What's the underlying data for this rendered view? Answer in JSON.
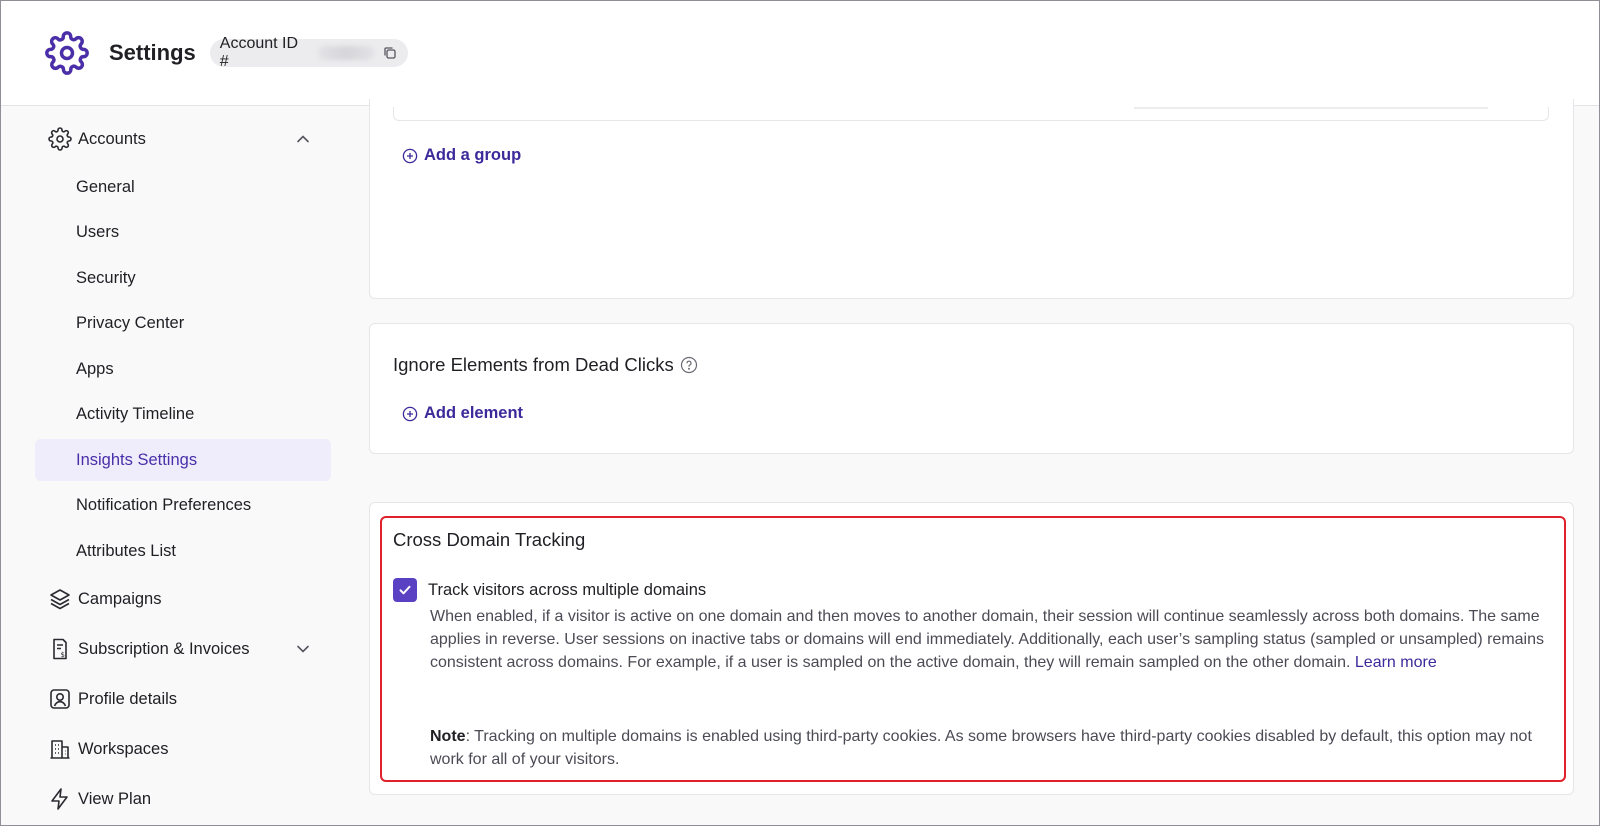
{
  "header": {
    "title": "Settings",
    "account_label": "Account ID #",
    "icons": {
      "logo": "gear-icon",
      "copy": "copy-icon"
    },
    "accent": "#4a2fa8"
  },
  "sidebar": {
    "accounts": {
      "label": "Accounts",
      "icon": "gear-icon",
      "expanded": true
    },
    "children": [
      {
        "label": "General"
      },
      {
        "label": "Users"
      },
      {
        "label": "Security"
      },
      {
        "label": "Privacy Center"
      },
      {
        "label": "Apps"
      },
      {
        "label": "Activity Timeline"
      },
      {
        "label": "Insights Settings",
        "active": true
      },
      {
        "label": "Notification Preferences"
      },
      {
        "label": "Attributes List"
      }
    ],
    "campaigns": {
      "label": "Campaigns",
      "icon": "layers-icon"
    },
    "subscription": {
      "label": "Subscription & Invoices",
      "icon": "invoice-icon"
    },
    "profile": {
      "label": "Profile details",
      "icon": "profile-icon"
    },
    "workspaces": {
      "label": "Workspaces",
      "icon": "building-icon"
    },
    "view_plan": {
      "label": "View Plan",
      "icon": "lightning-icon"
    }
  },
  "main": {
    "groups_card": {
      "add_label": "Add a group"
    },
    "dead_clicks_card": {
      "title": "Ignore Elements from Dead Clicks",
      "add_label": "Add element"
    },
    "cross_domain_card": {
      "title": "Cross Domain Tracking",
      "checkbox_label": "Track visitors across multiple domains",
      "checked": true,
      "description": "When enabled, if a visitor is active on one domain and then moves to another domain, their session will continue seamlessly across both domains. The same applies in reverse. User sessions on inactive tabs or domains will end immediately. Additionally, each user’s sampling status (sampled or unsampled) remains consistent across domains. For example, if a user is sampled on the active domain, they will remain sampled on the other domain.",
      "learn_more": "Learn more",
      "note_label": "Note",
      "note_text": ": Tracking on multiple domains is enabled using third-party cookies. As some browsers have third-party cookies disabled by default, this option may not work for all of your visitors."
    }
  }
}
